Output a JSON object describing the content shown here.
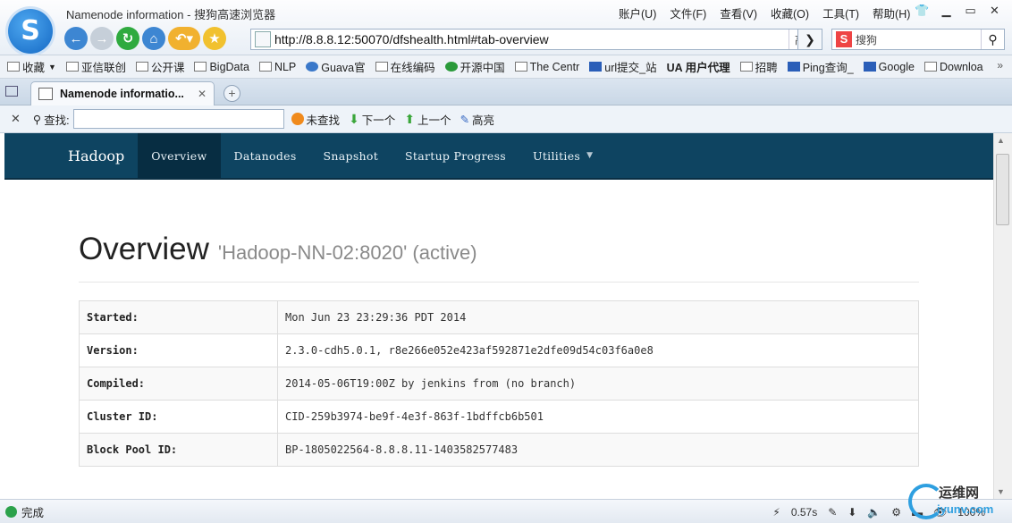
{
  "window": {
    "title": "Namenode information - 搜狗高速浏览器",
    "menu": [
      "账户(U)",
      "文件(F)",
      "查看(V)",
      "收藏(O)",
      "工具(T)",
      "帮助(H)"
    ]
  },
  "address_bar": {
    "url": "http://8.8.8.12:50070/dfshealth.html#tab-overview",
    "speed_label": "高速"
  },
  "search_box": {
    "placeholder": "搜狗"
  },
  "bookmarks": [
    {
      "label": "收藏",
      "icon": "favorites-icon"
    },
    {
      "label": "亚信联创",
      "icon": "folder-icon"
    },
    {
      "label": "公开课",
      "icon": "folder-icon"
    },
    {
      "label": "BigData",
      "icon": "folder-icon"
    },
    {
      "label": "NLP",
      "icon": "folder-icon"
    },
    {
      "label": "Guava官",
      "icon": "globe-icon"
    },
    {
      "label": "在线编码",
      "icon": "folder-icon"
    },
    {
      "label": "开源中国",
      "icon": "oschina-icon"
    },
    {
      "label": "The Centr",
      "icon": "page-icon"
    },
    {
      "label": "url提交_站",
      "icon": "paw-icon"
    },
    {
      "label": "UA 用户代理",
      "icon": "page-icon"
    },
    {
      "label": "招聘",
      "icon": "folder-icon"
    },
    {
      "label": "Ping查询_",
      "icon": "page-icon"
    },
    {
      "label": "Google",
      "icon": "google-icon"
    },
    {
      "label": "Downloa",
      "icon": "page-icon"
    }
  ],
  "tab": {
    "label": "Namenode informatio..."
  },
  "findbar": {
    "label": "查找:",
    "not_found": "未查找",
    "next": "下一个",
    "prev": "上一个",
    "highlight": "高亮"
  },
  "hadoop_nav": {
    "brand": "Hadoop",
    "items": [
      "Overview",
      "Datanodes",
      "Snapshot",
      "Startup Progress",
      "Utilities"
    ]
  },
  "overview": {
    "title": "Overview",
    "subtitle": "'Hadoop-NN-02:8020' (active)",
    "rows": [
      {
        "key": "Started:",
        "value": "Mon Jun 23 23:29:36 PDT 2014"
      },
      {
        "key": "Version:",
        "value": "2.3.0-cdh5.0.1, r8e266e052e423af592871e2dfe09d54c03f6a0e8"
      },
      {
        "key": "Compiled:",
        "value": "2014-05-06T19:00Z by jenkins from (no branch)"
      },
      {
        "key": "Cluster ID:",
        "value": "CID-259b3974-be9f-4e3f-863f-1bdffcb6b501"
      },
      {
        "key": "Block Pool ID:",
        "value": "BP-1805022564-8.8.8.11-1403582577483"
      }
    ]
  },
  "status_bar": {
    "status": "完成",
    "load_time": "0.57s",
    "zoom": "100%"
  },
  "watermark": {
    "name": "运维网",
    "domain": "iyunv.com"
  },
  "colors": {
    "hadoop_nav_bg": "#0e4461",
    "hadoop_nav_active": "#072d42"
  }
}
